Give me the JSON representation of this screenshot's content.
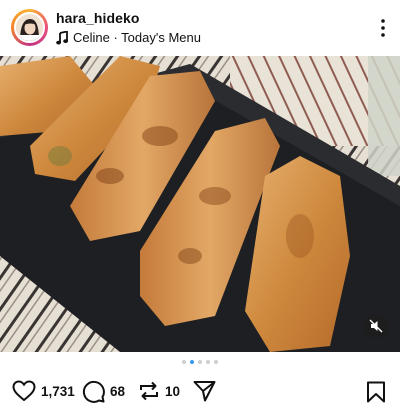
{
  "post": {
    "username": "hara_hideko",
    "audio": "Celine · Today's Menu"
  },
  "carousel": {
    "total": 5,
    "active_index": 1
  },
  "actions": {
    "likes": "1,731",
    "comments": "68",
    "reposts": "10"
  },
  "icons": [
    "music-icon",
    "more-icon",
    "mute-icon",
    "heart-icon",
    "comment-icon",
    "repost-icon",
    "share-icon",
    "bookmark-icon"
  ]
}
